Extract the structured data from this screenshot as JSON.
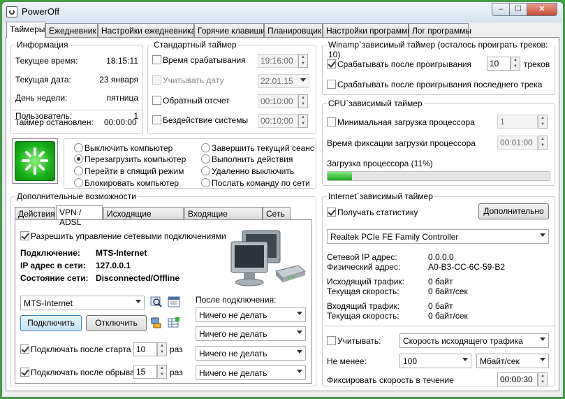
{
  "window": {
    "title": "PowerOff",
    "min": "–",
    "max": "☐",
    "close": "✕"
  },
  "tabs": [
    "Таймеры",
    "Ежедневник",
    "Настройки ежедневника",
    "Горячие клавиши",
    "Планировщик",
    "Настройки программы",
    "Лог программы"
  ],
  "info": {
    "legend": "Информация",
    "rows": [
      {
        "label": "Текущее время:",
        "value": "18:15:11"
      },
      {
        "label": "Текущая дата:",
        "value": "23 января"
      },
      {
        "label": "День недели:",
        "value": "пятница"
      },
      {
        "label": "Пользователь:",
        "value": "1"
      }
    ],
    "timer_label": "Таймер остановлен:",
    "timer_value": "00:00:00"
  },
  "std": {
    "legend": "Стандартный таймер",
    "rows": [
      {
        "label": "Время срабатывания",
        "value": "19:16:00"
      },
      {
        "label": "Учитывать дату",
        "value": "22.01.15"
      },
      {
        "label": "Обратный отсчет",
        "value": "00:10:00"
      },
      {
        "label": "Бездействие системы",
        "value": "00:10:00"
      }
    ]
  },
  "actions": [
    "Выключить компьютер",
    "Перезагрузить компьютер",
    "Перейти в спящий режим",
    "Блокировать компьютер",
    "Завершить текущий сеанс",
    "Выполнить действия",
    "Удаленно выключить",
    "Послать команду по сети"
  ],
  "extra": {
    "legend": "Дополнительные возможности",
    "tabs": [
      "Действия",
      "VPN / ADSL",
      "Исходящие команды",
      "Входящие команды",
      "Сеть"
    ],
    "allow": "Разрешить управление сетевыми подключениями",
    "conn_label": "Подключение:",
    "conn_value": "MTS-Internet",
    "ip_label": "IP адрес в сети:",
    "ip_value": "127.0.0.1",
    "state_label": "Состояние сети:",
    "state_value": "Disconnected/Offline",
    "conn_select": "MTS-Internet",
    "connect": "Подключить",
    "disconnect": "Отключить",
    "after_label": "После подключения:",
    "after_opts": [
      "Ничего не делать",
      "Ничего не делать",
      "Ничего не делать",
      "Ничего не делать"
    ],
    "on_start": "Подключать после старта",
    "on_start_n": "10",
    "on_break": "Подключать после обрыва",
    "on_break_n": "15",
    "times": "раз"
  },
  "winamp": {
    "legend": "Winamp`зависимый таймер (осталось проиграть треков: 10)",
    "after": "Срабатывать после проигрывания",
    "count": "10",
    "tracks": "треков",
    "after_last": "Срабатывать после проигрывания последнего трека"
  },
  "cpu": {
    "legend": "CPU`зависимый таймер",
    "min_load": "Минимальная загрузка процессора",
    "min_val": "1",
    "fix_label": "Время фиксации загрузки процессора",
    "fix_val": "00:01:00",
    "load_label": "Загрузка процессора (11%)",
    "load_pct": 11
  },
  "net": {
    "legend": "Internet`зависимый таймер",
    "stats": "Получать статистику",
    "more": "Дополнительно",
    "adapter": "Realtek PCIe FE Family Controller",
    "rows": [
      {
        "label": "Сетевой IP адрес:",
        "value": "0.0.0.0"
      },
      {
        "label": "Физический адрес:",
        "value": "A0-B3-CC-6C-59-B2"
      },
      {
        "label": "Исходящий трафик:",
        "value": "0 байт"
      },
      {
        "label": "Текущая скорость:",
        "value": "0 байт/сек"
      },
      {
        "label": "Входящий трафик:",
        "value": "0 байт"
      },
      {
        "label": "Текущая скорость:",
        "value": "0 байт/сек"
      }
    ],
    "consider": "Учитывать:",
    "consider_val": "Скорость исходящего трафика",
    "min_label": "Не менее:",
    "min_val": "100",
    "unit": "Мбайт/сек",
    "fix_label": "Фиксировать скорость в течение",
    "fix_val": "00:00:30"
  }
}
